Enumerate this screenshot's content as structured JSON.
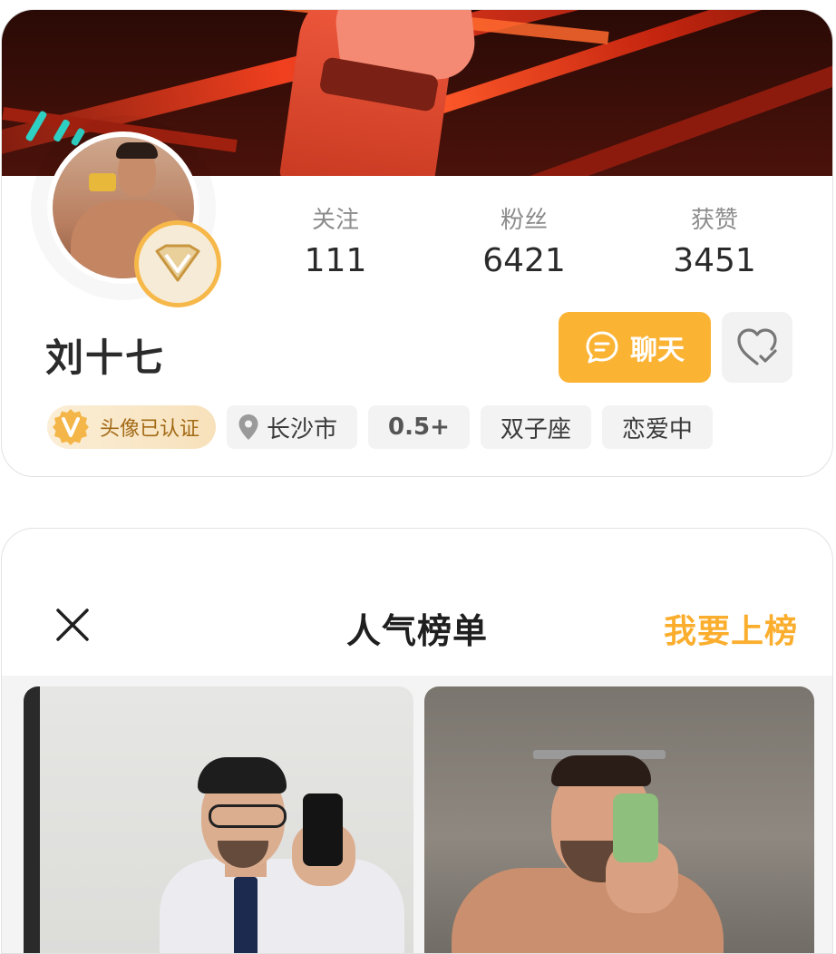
{
  "profile": {
    "name": "刘十七",
    "stats": [
      {
        "label": "关注",
        "value": "111"
      },
      {
        "label": "粉丝",
        "value": "6421"
      },
      {
        "label": "获赞",
        "value": "3451"
      }
    ],
    "chat_label": "聊天",
    "tags": {
      "verified": "头像已认证",
      "location": "长沙市",
      "role": "0.5+",
      "zodiac": "双子座",
      "relationship": "恋爱中"
    },
    "icons": {
      "avatar_badge": "vip-diamond-icon",
      "chat": "chat-bubble-icon",
      "favorite": "heart-check-icon",
      "location": "location-pin-icon",
      "verified": "v-seal-icon"
    }
  },
  "ranking": {
    "title": "人气榜单",
    "cta": "我要上榜",
    "close_icon": "close-icon"
  },
  "colors": {
    "accent": "#fbb334",
    "cta_text": "#fbae2e",
    "tag_bg": "#f3f3f3",
    "verified_text": "#a36a16"
  }
}
